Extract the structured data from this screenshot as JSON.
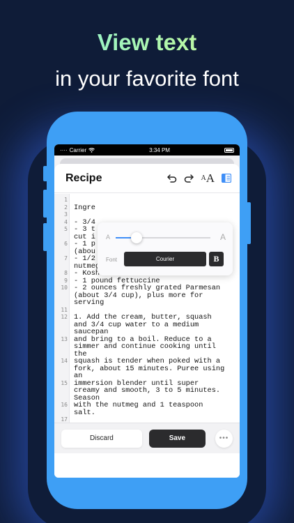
{
  "headline": {
    "line1": "View text",
    "line2": "in your favorite font"
  },
  "statusbar": {
    "carrier": "Carrier",
    "time": "3:34 PM"
  },
  "toolbar": {
    "title": "Recipe",
    "undo_icon": "undo-icon",
    "redo_icon": "redo-icon",
    "font_size_icon": "font-size-icon",
    "sidebar_icon": "sidebar-icon",
    "font_size_small": "A",
    "font_size_large": "A"
  },
  "font_popover": {
    "size_min_label": "A",
    "size_max_label": "A",
    "size_level": 0.22,
    "font_label": "Font",
    "font_name": "Courier",
    "bold_label": "B"
  },
  "editor": {
    "lines": [
      {
        "num": "1",
        "text": ""
      },
      {
        "num": "2",
        "text": "Ingre"
      },
      {
        "num": "3",
        "text": ""
      },
      {
        "num": "4",
        "text": "- 3/4"
      },
      {
        "num": "5",
        "text": "- 3 t\ncut i"
      },
      {
        "num": "6",
        "text": "- 1 p\n(abou"
      },
      {
        "num": "7",
        "text": "- 1/2 teaspoon freshly grated\nnutmeg, plus more for serving"
      },
      {
        "num": "8",
        "text": "- Kosher salt"
      },
      {
        "num": "9",
        "text": "- 1 pound fettuccine"
      },
      {
        "num": "10",
        "text": "- 2 ounces freshly grated Parmesan\n(about 3/4 cup), plus more for\nserving"
      },
      {
        "num": "11",
        "text": ""
      },
      {
        "num": "12",
        "text": "1. Add the cream, butter, squash\nand 3/4 cup water to a medium\nsaucepan"
      },
      {
        "num": "13",
        "text": "and bring to a boil. Reduce to a\nsimmer and continue cooking until\nthe"
      },
      {
        "num": "14",
        "text": "squash is tender when poked with a\nfork, about 15 minutes. Puree using\nan"
      },
      {
        "num": "15",
        "text": "immersion blender until super\ncreamy and smooth, 3 to 5 minutes.\nSeason"
      },
      {
        "num": "16",
        "text": "with the nutmeg and 1 teaspoon\nsalt."
      },
      {
        "num": "17",
        "text": ""
      }
    ]
  },
  "bottombar": {
    "discard_label": "Discard",
    "save_label": "Save",
    "more_label": "•••"
  },
  "colors": {
    "accent": "#3e9ff5",
    "background": "#0f1c38",
    "dark_button": "#2b2b2d"
  }
}
